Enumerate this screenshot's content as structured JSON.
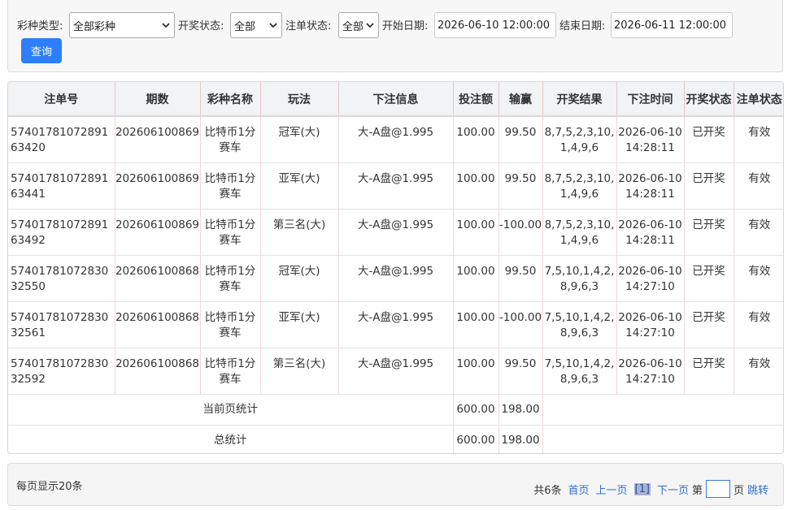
{
  "filters": {
    "lottery_type_label": "彩种类型:",
    "lottery_type_value": "全部彩种",
    "draw_status_label": "开奖状态:",
    "draw_status_value": "全部",
    "order_status_label": "注单状态:",
    "order_status_value": "全部",
    "start_date_label": "开始日期:",
    "start_date_value": "2026-06-10 12:00:00",
    "end_date_label": "结束日期:",
    "end_date_value": "2026-06-11 12:00:00",
    "query_button": "查询"
  },
  "table": {
    "headers": [
      "注单号",
      "期数",
      "彩种名称",
      "玩法",
      "下注信息",
      "投注额",
      "输赢",
      "开奖结果",
      "下注时间",
      "开奖状态",
      "注单状态"
    ],
    "rows": [
      {
        "order_no": "5740178107289163420",
        "issue": "202606100869",
        "lottery": "比特币1分赛车",
        "play": "冠军(大)",
        "bet_info": "大-A盘@1.995",
        "amount": "100.00",
        "win_loss": "99.50",
        "result": "8,7,5,2,3,10,1,4,9,6",
        "bet_time": "2026-06-10 14:28:11",
        "draw_status": "已开奖",
        "order_status": "有效"
      },
      {
        "order_no": "5740178107289163441",
        "issue": "202606100869",
        "lottery": "比特币1分赛车",
        "play": "亚军(大)",
        "bet_info": "大-A盘@1.995",
        "amount": "100.00",
        "win_loss": "99.50",
        "result": "8,7,5,2,3,10,1,4,9,6",
        "bet_time": "2026-06-10 14:28:11",
        "draw_status": "已开奖",
        "order_status": "有效"
      },
      {
        "order_no": "5740178107289163492",
        "issue": "202606100869",
        "lottery": "比特币1分赛车",
        "play": "第三名(大)",
        "bet_info": "大-A盘@1.995",
        "amount": "100.00",
        "win_loss": "-100.00",
        "result": "8,7,5,2,3,10,1,4,9,6",
        "bet_time": "2026-06-10 14:28:11",
        "draw_status": "已开奖",
        "order_status": "有效"
      },
      {
        "order_no": "5740178107283032550",
        "issue": "202606100868",
        "lottery": "比特币1分赛车",
        "play": "冠军(大)",
        "bet_info": "大-A盘@1.995",
        "amount": "100.00",
        "win_loss": "99.50",
        "result": "7,5,10,1,4,2,8,9,6,3",
        "bet_time": "2026-06-10 14:27:10",
        "draw_status": "已开奖",
        "order_status": "有效"
      },
      {
        "order_no": "5740178107283032561",
        "issue": "202606100868",
        "lottery": "比特币1分赛车",
        "play": "亚军(大)",
        "bet_info": "大-A盘@1.995",
        "amount": "100.00",
        "win_loss": "-100.00",
        "result": "7,5,10,1,4,2,8,9,6,3",
        "bet_time": "2026-06-10 14:27:10",
        "draw_status": "已开奖",
        "order_status": "有效"
      },
      {
        "order_no": "5740178107283032592",
        "issue": "202606100868",
        "lottery": "比特币1分赛车",
        "play": "第三名(大)",
        "bet_info": "大-A盘@1.995",
        "amount": "100.00",
        "win_loss": "99.50",
        "result": "7,5,10,1,4,2,8,9,6,3",
        "bet_time": "2026-06-10 14:27:10",
        "draw_status": "已开奖",
        "order_status": "有效"
      }
    ],
    "page_total": {
      "label": "当前页统计",
      "amount": "600.00",
      "win_loss": "198.00"
    },
    "grand_total": {
      "label": "总统计",
      "amount": "600.00",
      "win_loss": "198.00"
    }
  },
  "footer": {
    "page_size_text": "每页显示20条",
    "total_text": "共6条",
    "first_page": "首页",
    "prev_page": "上一页",
    "current_page": "[1]",
    "next_page": "下一页",
    "goto_prefix": "第",
    "goto_suffix": "页",
    "jump": "跳转"
  }
}
